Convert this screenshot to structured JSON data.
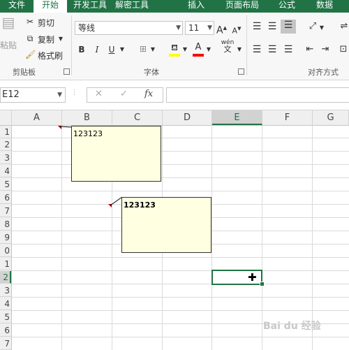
{
  "tabs": [
    "文件",
    "开始",
    "开发工具",
    "解密工具",
    "插入",
    "页面布局",
    "公式",
    "数据"
  ],
  "clipboard": {
    "paste_label": "粘贴",
    "cut_label": "剪切",
    "copy_label": "复制",
    "format_painter_label": "格式刷",
    "group_label": "剪贴板"
  },
  "font": {
    "font_name": "等线",
    "font_size": "11",
    "grow_label": "A",
    "shrink_label": "A",
    "bold_label": "B",
    "italic_label": "I",
    "underline_label": "U",
    "highlight_label": "A",
    "font_color_label": "A",
    "phonetic_top": "wén",
    "phonetic_bottom": "文",
    "group_label": "字体"
  },
  "alignment": {
    "group_label": "对齐方式"
  },
  "formula_bar": {
    "name_box": "E12",
    "cancel": "✕",
    "enter": "✓",
    "fx": "fx",
    "formula": ""
  },
  "columns": [
    "A",
    "B",
    "C",
    "D",
    "E",
    "F",
    "G"
  ],
  "rows": [
    "1",
    "2",
    "3",
    "4",
    "5",
    "6",
    "7",
    "8",
    "9",
    "0",
    "1",
    "2",
    "3",
    "4",
    "5",
    "6",
    "7"
  ],
  "active_cell": "E12",
  "comments": [
    {
      "text": "123123",
      "bold": false
    },
    {
      "text": "123123",
      "bold": true
    }
  ],
  "watermark": "Bai du 经验",
  "colors": {
    "accent": "#217346",
    "comment_bg": "#ffffe1",
    "comment_indicator": "#c00000",
    "font_color_bar": "#ff0000",
    "highlight_bar": "#ffff00"
  }
}
